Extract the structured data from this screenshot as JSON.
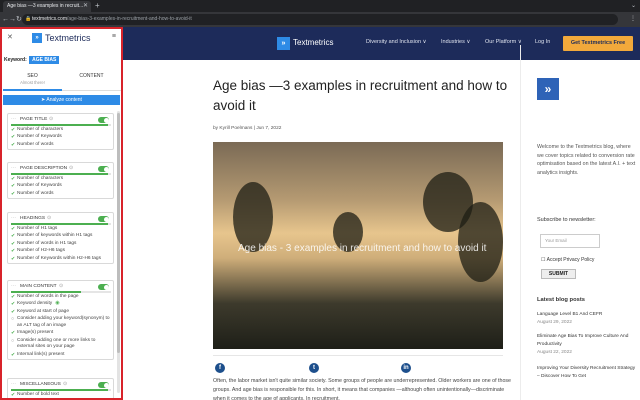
{
  "browser": {
    "tab_title": "Age bias —3 examples in recruit...",
    "url_host": "textmetrics.com",
    "url_path": "/age-bias-3-examples-in-recruitment-and-how-to-avoid-it"
  },
  "site": {
    "logo": "Textmetrics",
    "nav": [
      "Diversity and Inclusion ∨",
      "Industries ∨",
      "Our Platform ∨",
      "Log In"
    ],
    "cta": "Get Textmetrics Free",
    "article_title": "Age bias —3 examples in recruitment and how to avoid it",
    "byline": "by Kyrill Poelmans | Jun 7, 2022",
    "hero_caption": "Age bias - 3 examples in recruitment and how to avoid it",
    "share_icons": [
      "f",
      "t",
      "in"
    ],
    "body": "Often, the labor market isn't quite similar society. Some groups of people are underrepresented. Older workers are one of those groups. And age bias is responsible for this. In short, it means that companies —although often unintentionally—discriminate when it comes to the age of applicants. In recruitment,",
    "sidebar": {
      "logo_icon": "»",
      "intro": "Welcome to the Textmetrics blog, where we cover topics related to conversion rate optimisation based on the latest A.I. + text analytics insights.",
      "subscribe_label": "Subscribe to newsletter:",
      "email_placeholder": "Your Email",
      "privacy_label": "Accept Privacy Policy",
      "submit_label": "SUBMIT",
      "latest_heading": "Latest blog posts",
      "posts": [
        {
          "title": "Language Level B1 And CEFR",
          "date": "August 29, 2022"
        },
        {
          "title": "Eliminate Age Bias To Improve Culture And Productivity",
          "date": "August 22, 2022"
        },
        {
          "title": "Improving Your Diversity Recruitment Strategy – Discover How To Get",
          "date": ""
        }
      ]
    }
  },
  "extension": {
    "logo": "Textmetrics",
    "keyword_label": "Keyword:",
    "keyword": "AGE BIAS",
    "tabs": [
      {
        "label": "SEO",
        "sub": "Almost there!",
        "active": true
      },
      {
        "label": "CONTENT",
        "sub": "",
        "active": false
      }
    ],
    "analyze_label": "Analyze content",
    "sections": [
      {
        "title": "PAGE TITLE",
        "progress": 0.97,
        "items": [
          {
            "text": "Number of characters",
            "ok": true
          },
          {
            "text": "Number of Keywords",
            "ok": true
          },
          {
            "text": "Number of words",
            "ok": true
          }
        ]
      },
      {
        "title": "PAGE DESCRIPTION",
        "progress": 0.97,
        "items": [
          {
            "text": "Number of characters",
            "ok": true
          },
          {
            "text": "Number of Keywords",
            "ok": true
          },
          {
            "text": "Number of words",
            "ok": true
          }
        ]
      },
      {
        "title": "HEADINGS",
        "progress": 0.97,
        "items": [
          {
            "text": "Number of H1 tags",
            "ok": true
          },
          {
            "text": "Number of keywords within H1 tags",
            "ok": true
          },
          {
            "text": "Number of words in H1 tags",
            "ok": true
          },
          {
            "text": "Number of H2-H6 tags",
            "ok": true
          },
          {
            "text": "Number of Keywords within H2-H6 tags",
            "ok": true
          }
        ]
      },
      {
        "title": "MAIN CONTENT",
        "progress": 0.7,
        "items": [
          {
            "text": "Number of words in the page",
            "ok": true
          },
          {
            "text": "Keyword density",
            "ok": true,
            "eye": true
          },
          {
            "text": "Keyword at start of page",
            "ok": true
          },
          {
            "text": "Consider adding your keyword(synonym) to an ALT tag of an image",
            "ok": false
          },
          {
            "text": "Image(s) present",
            "ok": true
          },
          {
            "text": "Consider adding one or more links to external sites on your page",
            "ok": false
          },
          {
            "text": "Internal link(s) present",
            "ok": true
          }
        ]
      },
      {
        "title": "MISCELLANEOUS",
        "progress": 0.97,
        "items": [
          {
            "text": "Number of bold text",
            "ok": true
          }
        ]
      }
    ]
  }
}
